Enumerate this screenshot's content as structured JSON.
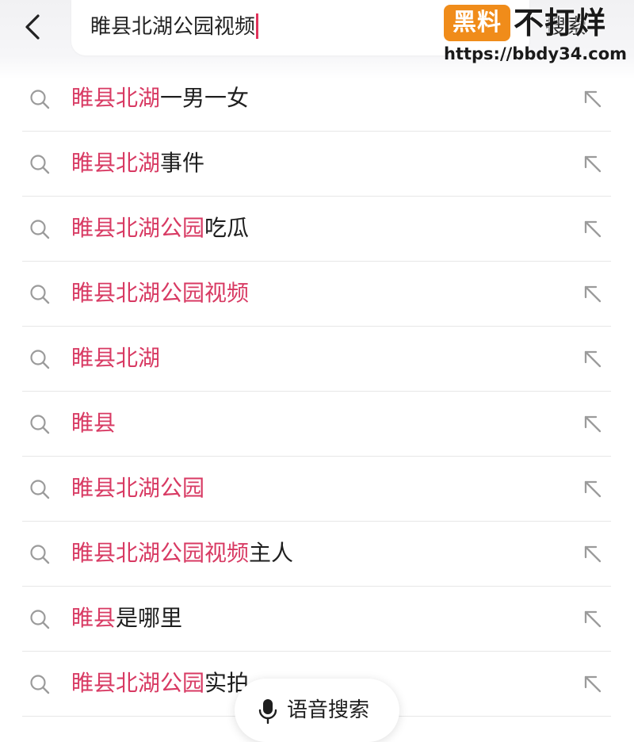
{
  "header": {
    "query": "睢县北湖公园视频",
    "search_label": "搜索"
  },
  "watermark": {
    "badge": "黑料",
    "text": "不打烊",
    "url": "https://bbdy34.com"
  },
  "suggestions": [
    {
      "highlight": "睢县北湖",
      "rest": "一男一女"
    },
    {
      "highlight": "睢县北湖",
      "rest": "事件"
    },
    {
      "highlight": "睢县北湖公园",
      "rest": "吃瓜"
    },
    {
      "highlight": "睢县北湖公园视频",
      "rest": ""
    },
    {
      "highlight": "睢县北湖",
      "rest": ""
    },
    {
      "highlight": "睢县",
      "rest": ""
    },
    {
      "highlight": "睢县北湖公园",
      "rest": ""
    },
    {
      "highlight": "睢县北湖公园视频",
      "rest": "主人"
    },
    {
      "highlight": "睢县",
      "rest": "是哪里"
    },
    {
      "highlight": "睢县北湖公园",
      "rest": "实拍"
    }
  ],
  "voice_search": {
    "label": "语音搜索"
  },
  "colors": {
    "highlight": "#d83a63",
    "caret": "#e0335b",
    "watermark_badge": "#f08c1a"
  }
}
